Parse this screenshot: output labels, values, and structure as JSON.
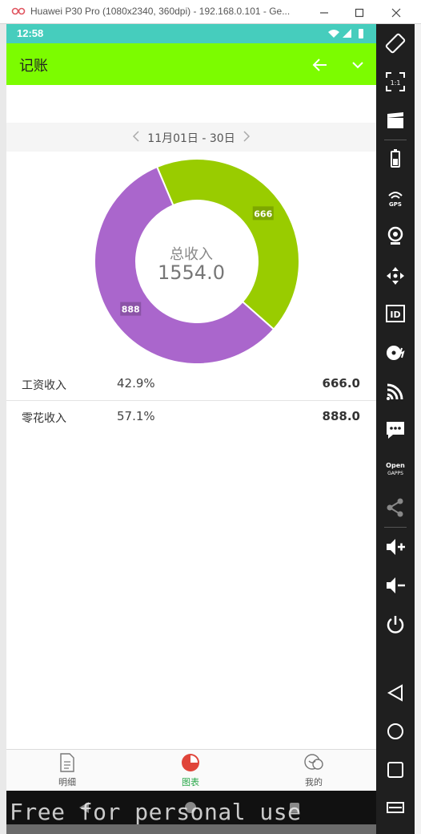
{
  "window": {
    "title": "Huawei P30 Pro (1080x2340, 360dpi) - 192.168.0.101 - Ge..."
  },
  "status_bar": {
    "time": "12:58"
  },
  "app_bar": {
    "title": "记账"
  },
  "date_range": {
    "label": "11月01日 - 30日"
  },
  "chart_data": {
    "type": "pie",
    "donut": true,
    "center_title": "总收入",
    "center_value": "1554.0",
    "slices": [
      {
        "label": "666",
        "value": 666,
        "color": "#99cc00"
      },
      {
        "label": "888",
        "value": 888,
        "color": "#aa66cc"
      }
    ]
  },
  "breakdown": [
    {
      "name": "工资收入",
      "percent": "42.9%",
      "amount": "666.0"
    },
    {
      "name": "零花收入",
      "percent": "57.1%",
      "amount": "888.0"
    }
  ],
  "bottom_nav": {
    "items": [
      {
        "label": "明细",
        "icon": "document-icon",
        "active": false
      },
      {
        "label": "图表",
        "icon": "pie-chart-icon",
        "active": true
      },
      {
        "label": "我的",
        "icon": "profile-icon",
        "active": false
      }
    ]
  },
  "watermark": "Free for personal use",
  "colors": {
    "status_bar": "#46cdbd",
    "app_bar": "#7cfc00",
    "active_tab": "#2aa84a"
  }
}
